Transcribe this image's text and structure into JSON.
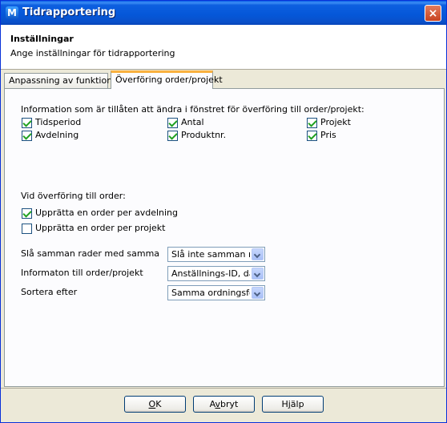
{
  "window": {
    "title": "Tidrapportering",
    "app_icon": "M",
    "close": "×"
  },
  "header": {
    "title": "Inställningar",
    "subtitle": "Ange inställningar för tidrapportering"
  },
  "tabs": [
    {
      "label": "Anpassning av funktioner",
      "active": false
    },
    {
      "label": "Överföring order/projekt",
      "active": true
    }
  ],
  "fields_section": {
    "label": "Information som är tillåten att ändra i fönstret för överföring till order/projekt:",
    "checkboxes": [
      {
        "label": "Tidsperiod",
        "checked": true
      },
      {
        "label": "Antal",
        "checked": true
      },
      {
        "label": "Projekt",
        "checked": true
      },
      {
        "label": "Avdelning",
        "checked": true
      },
      {
        "label": "Produktnr.",
        "checked": true
      },
      {
        "label": "Pris",
        "checked": true
      }
    ]
  },
  "order_section": {
    "label": "Vid överföring till order:",
    "options": [
      {
        "label": "Upprätta en order per avdelning",
        "checked": true
      },
      {
        "label": "Upprätta en order per projekt",
        "checked": false
      }
    ]
  },
  "settings": [
    {
      "label": "Slå samman rader med samma",
      "value": "Slå inte samman rader"
    },
    {
      "label": "Informaton till order/projekt",
      "value": "Anställnings-ID, datum"
    },
    {
      "label": "Sortera efter",
      "value": "Samma ordningsföljd"
    }
  ],
  "buttons": {
    "ok": {
      "accel": "O",
      "rest": "K"
    },
    "cancel": {
      "pre": "A",
      "accel": "v",
      "rest": "bryt"
    },
    "help": {
      "pre": "H",
      "accel": "j",
      "rest": "älp"
    }
  }
}
